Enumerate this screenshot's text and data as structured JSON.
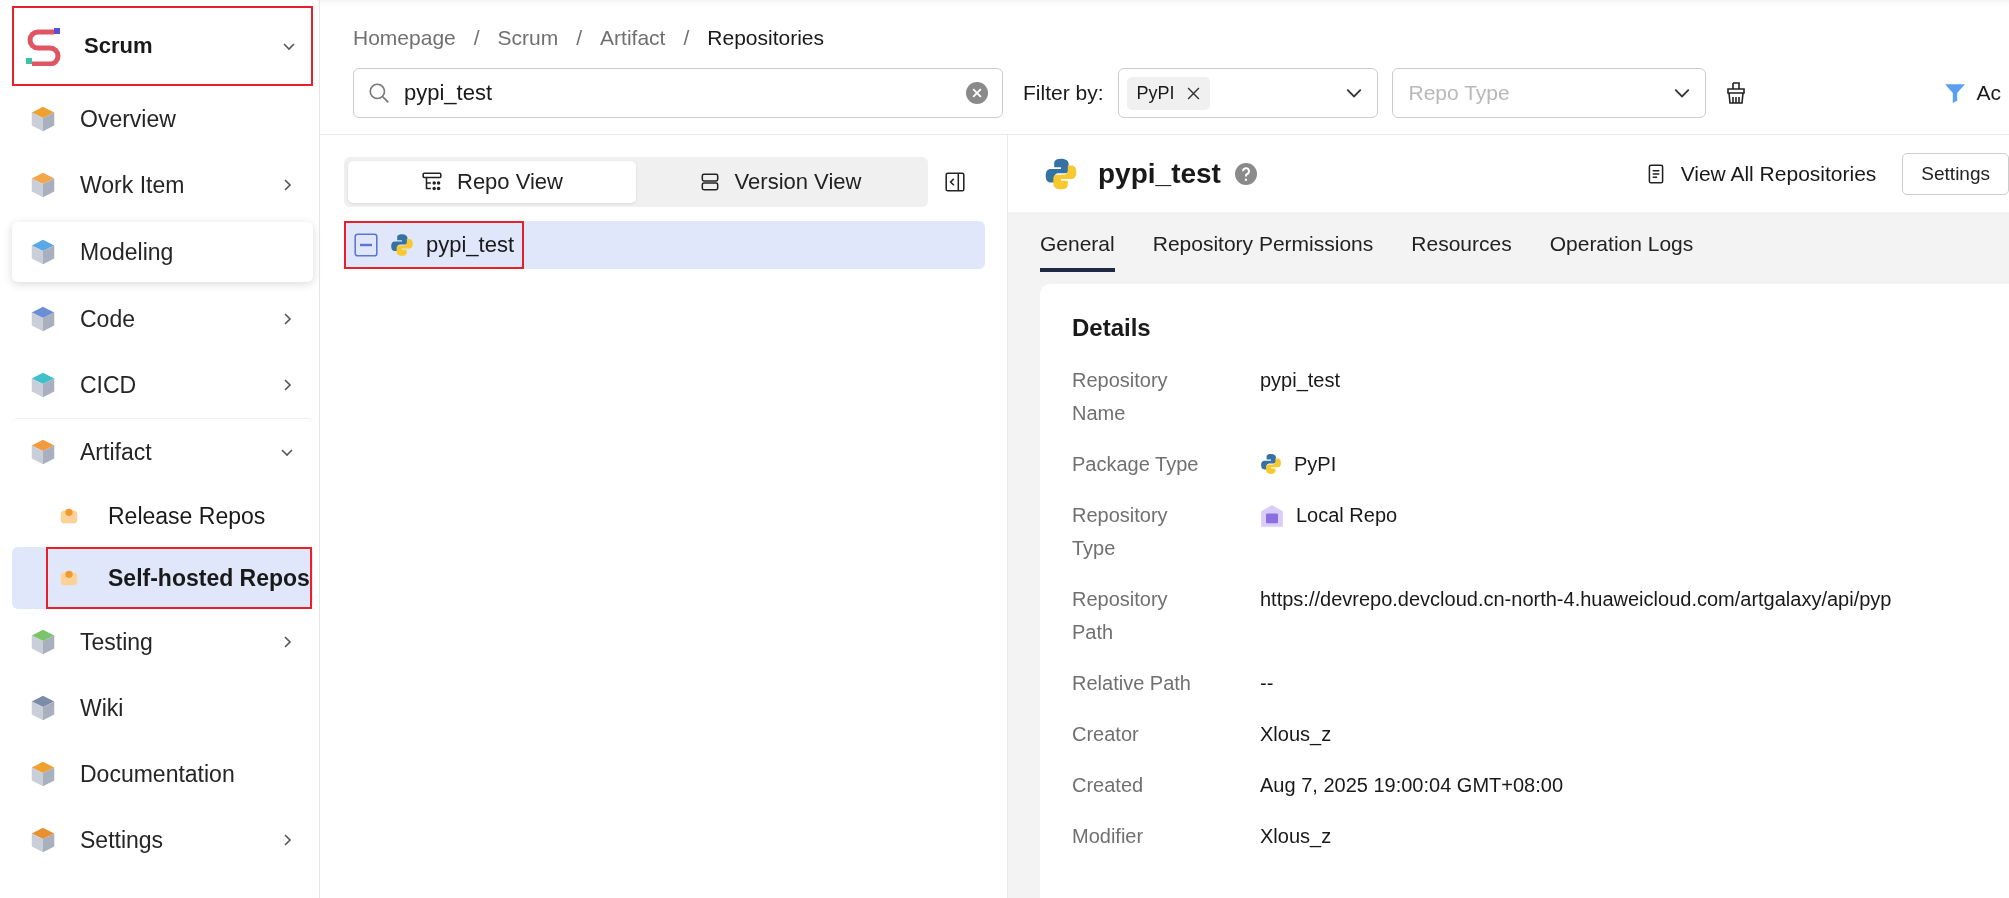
{
  "sidebar": {
    "project": {
      "name": "Scrum",
      "expanded": true,
      "highlighted": true
    },
    "items": [
      {
        "label": "Overview",
        "kind": "link",
        "selected": false,
        "hovered": false,
        "highlighted": false
      },
      {
        "label": "Work Item",
        "kind": "group",
        "expanded": false,
        "selected": false,
        "hovered": false,
        "highlighted": false
      },
      {
        "label": "Modeling",
        "kind": "link",
        "selected": false,
        "hovered": true,
        "highlighted": false
      },
      {
        "label": "Code",
        "kind": "group",
        "expanded": false,
        "selected": false,
        "hovered": false,
        "highlighted": false
      },
      {
        "label": "CICD",
        "kind": "group",
        "expanded": false,
        "selected": false,
        "hovered": false,
        "highlighted": false
      },
      {
        "label": "Artifact",
        "kind": "group",
        "expanded": true,
        "selected": false,
        "hovered": false,
        "highlighted": false,
        "children": [
          {
            "label": "Release Repos",
            "selected": false,
            "highlighted": false
          },
          {
            "label": "Self-hosted Repos",
            "selected": true,
            "highlighted": true
          }
        ]
      },
      {
        "label": "Testing",
        "kind": "group",
        "expanded": false,
        "selected": false,
        "hovered": false,
        "highlighted": false
      },
      {
        "label": "Wiki",
        "kind": "link",
        "selected": false,
        "hovered": false,
        "highlighted": false
      },
      {
        "label": "Documentation",
        "kind": "link",
        "selected": false,
        "hovered": false,
        "highlighted": false
      },
      {
        "label": "Settings",
        "kind": "group",
        "expanded": false,
        "selected": false,
        "hovered": false,
        "highlighted": false
      }
    ]
  },
  "breadcrumb": [
    {
      "label": "Homepage"
    },
    {
      "separator": "/",
      "label": "Scrum"
    },
    {
      "separator": "/",
      "label": "Artifact"
    },
    {
      "separator": "/",
      "label": "Repositories"
    }
  ],
  "search": {
    "value": "pypi_test"
  },
  "filter": {
    "label": "Filter by:",
    "tags": [
      "PyPI"
    ],
    "repo_type_placeholder": "Repo Type",
    "advanced_button": "Ac"
  },
  "view_tabs": [
    {
      "label": "Repo View",
      "selected": true
    },
    {
      "label": "Version View",
      "selected": false
    }
  ],
  "tree": [
    {
      "label": "pypi_test",
      "selected": true,
      "expanded": true,
      "highlighted": true
    }
  ],
  "repository": {
    "title": "pypi_test",
    "view_all": "View All Repositories",
    "settings_button": "Settings",
    "tabs": [
      {
        "label": "General",
        "selected": true
      },
      {
        "label": "Repository Permissions",
        "selected": false
      },
      {
        "label": "Resources",
        "selected": false
      },
      {
        "label": "Operation Logs",
        "selected": false
      }
    ],
    "details_title": "Details",
    "details": [
      {
        "label": "Repository Name",
        "value": "pypi_test",
        "kind": "text"
      },
      {
        "label": "Package Type",
        "value": "PyPI",
        "kind": "python"
      },
      {
        "label": "Repository Type",
        "value": "Local Repo",
        "kind": "local"
      },
      {
        "label": "Repository Path",
        "value": "https://devrepo.devcloud.cn-north-4.huaweicloud.com/artgalaxy/api/pyp",
        "kind": "text"
      },
      {
        "label": "Relative Path",
        "value": "--",
        "kind": "text"
      },
      {
        "label": "Creator",
        "value": "Xlous_z",
        "kind": "text"
      },
      {
        "label": "Created",
        "value": "Aug 7, 2025 19:00:04 GMT+08:00",
        "kind": "text"
      },
      {
        "label": "Modifier",
        "value": "Xlous_z",
        "kind": "text"
      }
    ]
  }
}
